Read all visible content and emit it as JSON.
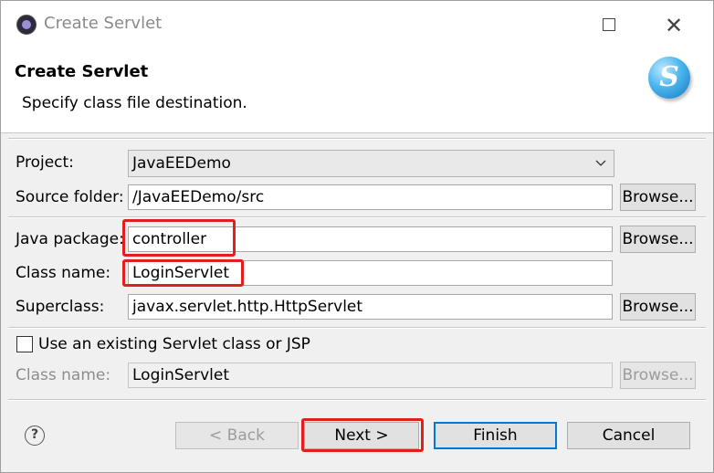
{
  "window": {
    "title": "Create Servlet",
    "close_glyph": "✕"
  },
  "banner": {
    "title": "Create Servlet",
    "description": "Specify class file destination.",
    "logo_letter": "S"
  },
  "form": {
    "project_label": "Project:",
    "project_value": "JavaEEDemo",
    "source_folder_label": "Source folder:",
    "source_folder_value": "/JavaEEDemo/src",
    "java_package_label": "Java package:",
    "java_package_value": "controller",
    "class_name_label": "Class name:",
    "class_name_value": "LoginServlet",
    "superclass_label": "Superclass:",
    "superclass_value": "javax.servlet.http.HttpServlet",
    "browse_label": "Browse...",
    "existing_checkbox_label": "Use an existing Servlet class or JSP",
    "existing_checked": false,
    "existing_class_name_label": "Class name:",
    "existing_class_name_value": "LoginServlet"
  },
  "footer": {
    "help_glyph": "?",
    "back_label": "< Back",
    "next_label": "Next >",
    "finish_label": "Finish",
    "cancel_label": "Cancel"
  },
  "colors": {
    "highlight": "#e31e1e",
    "default_button_border": "#0078d7"
  }
}
